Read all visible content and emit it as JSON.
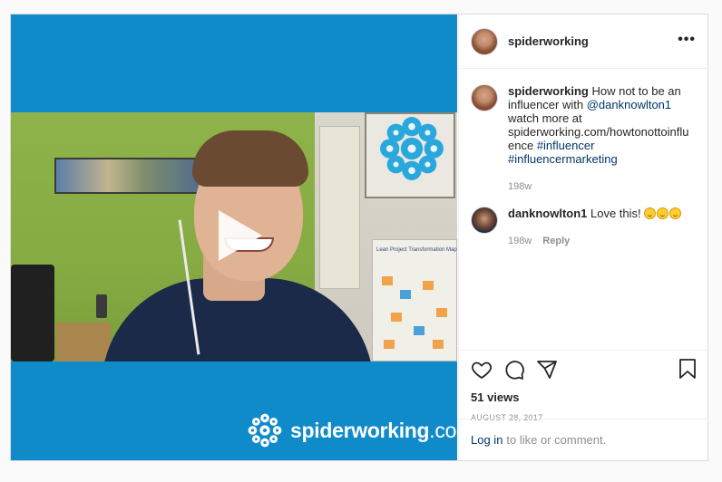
{
  "post": {
    "brand_logo_text": "spiderworking",
    "brand_logo_suffix": ".com",
    "video_map_title": "Lean Project Transformation Map",
    "play_icon": "play-icon"
  },
  "header": {
    "username": "spiderworking",
    "more_icon": "more-horizontal-icon"
  },
  "caption": {
    "username": "spiderworking",
    "text_before": " How not to be an influencer with ",
    "mention": "@danknowlton1",
    "text_middle": " watch more at spiderworking.com/howtonottoinfluence ",
    "hashtag1": "#influencer",
    "hashtag2": "#influencermarketing",
    "age": "198w"
  },
  "comments": [
    {
      "username": "danknowlton1",
      "text": " Love this! ",
      "emojis": 3,
      "age": "198w",
      "reply_label": "Reply"
    }
  ],
  "actions": {
    "like_icon": "heart-icon",
    "comment_icon": "comment-icon",
    "share_icon": "share-icon",
    "save_icon": "bookmark-icon",
    "views": "51 views",
    "date": "AUGUST 28, 2017"
  },
  "login": {
    "link_label": "Log in",
    "rest": "to like or comment."
  },
  "colors": {
    "brand_blue": "#0f8bc9",
    "link": "#00376b",
    "muted": "#8e8e8e"
  }
}
